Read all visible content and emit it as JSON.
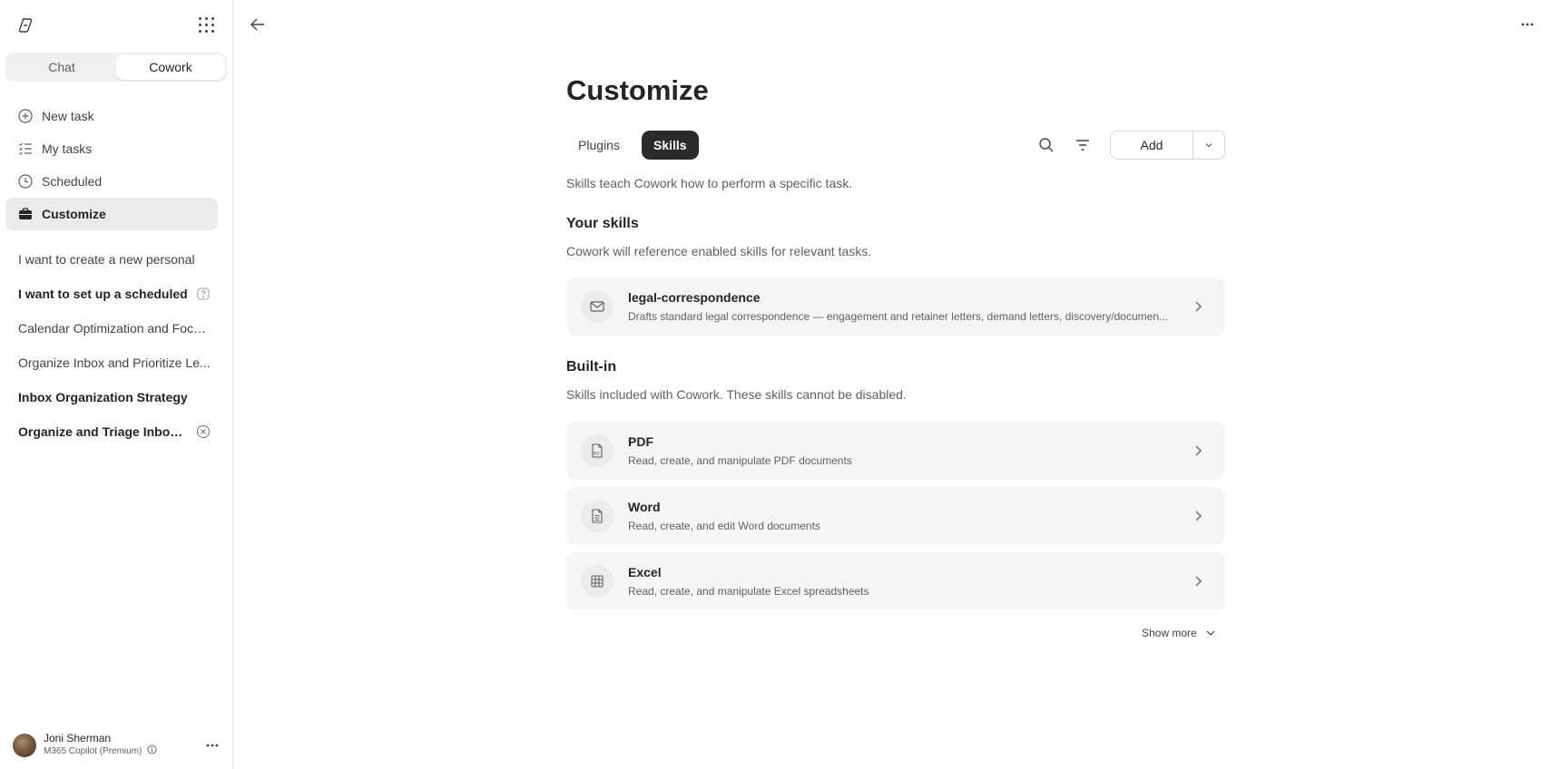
{
  "sidebar": {
    "mode_tabs": [
      "Chat",
      "Cowork"
    ],
    "active_mode": "Cowork",
    "nav": [
      {
        "label": "New task",
        "icon": "plus-circle-icon"
      },
      {
        "label": "My tasks",
        "icon": "task-list-icon"
      },
      {
        "label": "Scheduled",
        "icon": "clock-icon"
      },
      {
        "label": "Customize",
        "icon": "briefcase-icon",
        "active": true
      }
    ],
    "recent": [
      {
        "label": "I want to create a new personal",
        "bold": false
      },
      {
        "label": "I want to set up a scheduled",
        "bold": true,
        "badge": "question-icon"
      },
      {
        "label": "Calendar Optimization and Focu...",
        "bold": false
      },
      {
        "label": "Organize Inbox and Prioritize Le...",
        "bold": false
      },
      {
        "label": "Inbox Organization Strategy",
        "bold": true
      },
      {
        "label": "Organize and Triage Inbox ...",
        "bold": true,
        "badge": "dismiss-circle-icon"
      }
    ],
    "user": {
      "name": "Joni Sherman",
      "plan": "M365 Copilot (Premium)"
    }
  },
  "main": {
    "title": "Customize",
    "tabs": [
      "Plugins",
      "Skills"
    ],
    "active_tab": "Skills",
    "add_label": "Add",
    "intro": "Skills teach Cowork how to perform a specific task.",
    "your_skills": {
      "heading": "Your skills",
      "subtitle": "Cowork will reference enabled skills for relevant tasks.",
      "items": [
        {
          "title": "legal-correspondence",
          "desc": "Drafts standard legal correspondence — engagement and retainer letters, demand letters, discovery/documen...",
          "icon": "mail-icon"
        }
      ]
    },
    "built_in": {
      "heading": "Built-in",
      "subtitle": "Skills included with Cowork. These skills cannot be disabled.",
      "items": [
        {
          "title": "PDF",
          "desc": "Read, create, and manipulate PDF documents",
          "icon": "pdf-icon"
        },
        {
          "title": "Word",
          "desc": "Read, create, and edit Word documents",
          "icon": "document-icon"
        },
        {
          "title": "Excel",
          "desc": "Read, create, and manipulate Excel spreadsheets",
          "icon": "table-icon"
        }
      ]
    },
    "show_more": "Show more"
  }
}
